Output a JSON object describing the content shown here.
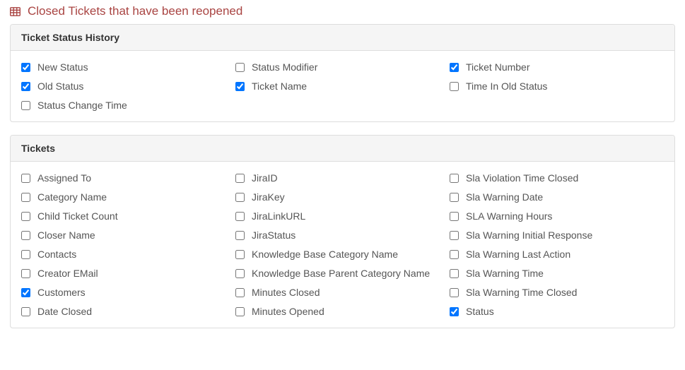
{
  "header": {
    "title": "Closed Tickets that have been reopened"
  },
  "sections": [
    {
      "title": "Ticket Status History",
      "columns": [
        [
          {
            "label": "New Status",
            "checked": true
          },
          {
            "label": "Old Status",
            "checked": true
          },
          {
            "label": "Status Change Time",
            "checked": false
          }
        ],
        [
          {
            "label": "Status Modifier",
            "checked": false
          },
          {
            "label": "Ticket Name",
            "checked": true
          }
        ],
        [
          {
            "label": "Ticket Number",
            "checked": true
          },
          {
            "label": "Time In Old Status",
            "checked": false
          }
        ]
      ]
    },
    {
      "title": "Tickets",
      "columns": [
        [
          {
            "label": "Assigned To",
            "checked": false
          },
          {
            "label": "Category Name",
            "checked": false
          },
          {
            "label": "Child Ticket Count",
            "checked": false
          },
          {
            "label": "Closer Name",
            "checked": false
          },
          {
            "label": "Contacts",
            "checked": false
          },
          {
            "label": "Creator EMail",
            "checked": false
          },
          {
            "label": "Customers",
            "checked": true
          },
          {
            "label": "Date Closed",
            "checked": false
          }
        ],
        [
          {
            "label": "JiraID",
            "checked": false
          },
          {
            "label": "JiraKey",
            "checked": false
          },
          {
            "label": "JiraLinkURL",
            "checked": false
          },
          {
            "label": "JiraStatus",
            "checked": false
          },
          {
            "label": "Knowledge Base Category Name",
            "checked": false
          },
          {
            "label": "Knowledge Base Parent Category Name",
            "checked": false
          },
          {
            "label": "Minutes Closed",
            "checked": false
          },
          {
            "label": "Minutes Opened",
            "checked": false
          }
        ],
        [
          {
            "label": "Sla Violation Time Closed",
            "checked": false
          },
          {
            "label": "Sla Warning Date",
            "checked": false
          },
          {
            "label": "SLA Warning Hours",
            "checked": false
          },
          {
            "label": "Sla Warning Initial Response",
            "checked": false
          },
          {
            "label": "Sla Warning Last Action",
            "checked": false
          },
          {
            "label": "Sla Warning Time",
            "checked": false
          },
          {
            "label": "Sla Warning Time Closed",
            "checked": false
          },
          {
            "label": "Status",
            "checked": true
          }
        ]
      ]
    }
  ]
}
